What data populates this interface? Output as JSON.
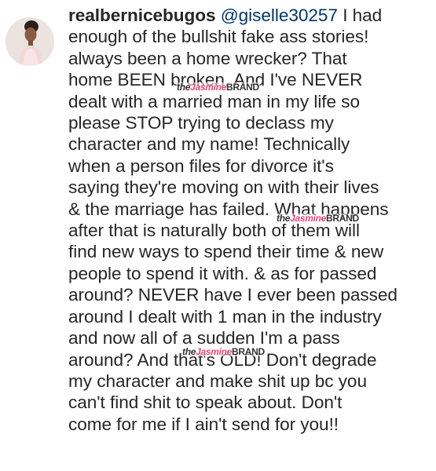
{
  "comment": {
    "avatar": "profile-photo",
    "username": "realbernicebugos",
    "mention": "@giselle30257",
    "lines": [
      "I had",
      "enough of the bullshit fake ass stories!",
      "always been a home wrecker? That",
      "home BEEN broken. And I've NEVER",
      "dealt with a married man in my life so",
      "please STOP trying to declass my",
      "character and my name! Technically",
      "when a person files for divorce it's",
      "saying they're moving on with their lives",
      "& the marriage has failed. What happens",
      "after that is naturally both of them will",
      "find new ways to spend their time & new",
      "people to spend it with. & as for passed",
      "around? NEVER have I ever been passed",
      "around I dealt with 1 man in the industry",
      "and now all of a sudden I'm a pass",
      "around? And that's OLD! Don't degrade",
      "my character and make shit up bc you",
      "can't find shit to speak about. Don't",
      "come for me if I ain't send for you!!"
    ]
  },
  "watermark": {
    "the": "the",
    "jasmine": "Jasmine",
    "brand": "BRAND"
  },
  "colors": {
    "text": "#262626",
    "mention": "#003569",
    "watermark_accent": "#e0457b"
  }
}
